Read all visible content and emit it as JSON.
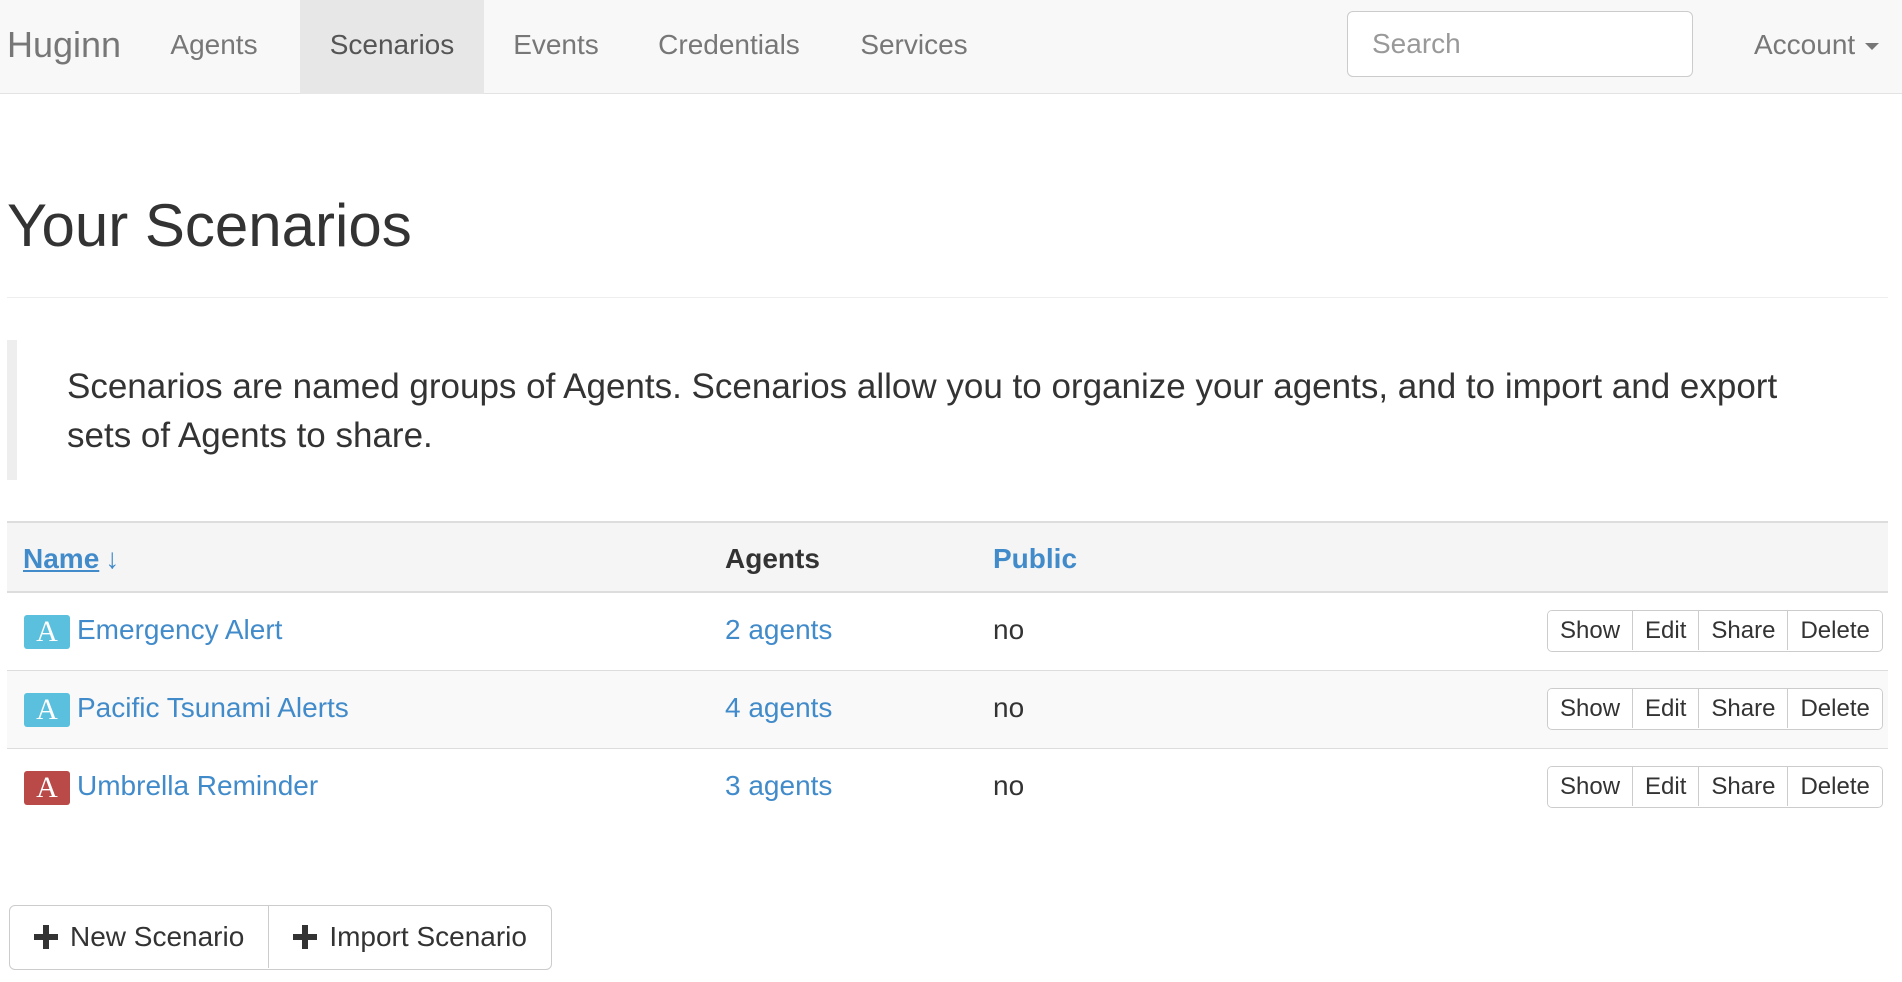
{
  "nav": {
    "brand": "Huginn",
    "items": [
      {
        "label": "Agents",
        "active": false
      },
      {
        "label": "Scenarios",
        "active": true
      },
      {
        "label": "Events",
        "active": false
      },
      {
        "label": "Credentials",
        "active": false
      },
      {
        "label": "Services",
        "active": false
      }
    ],
    "search_placeholder": "Search",
    "account_label": "Account"
  },
  "page": {
    "title": "Your Scenarios",
    "description": "Scenarios are named groups of Agents. Scenarios allow you to organize your agents, and to import and export sets of Agents to share."
  },
  "table": {
    "headers": {
      "name": "Name",
      "sort_indicator": "↓",
      "agents": "Agents",
      "public": "Public"
    },
    "rows": [
      {
        "icon_letter": "A",
        "icon_color": "#5bc0de",
        "name": "Emergency Alert",
        "agents": "2 agents",
        "public": "no"
      },
      {
        "icon_letter": "A",
        "icon_color": "#5bc0de",
        "name": "Pacific Tsunami Alerts",
        "agents": "4 agents",
        "public": "no"
      },
      {
        "icon_letter": "A",
        "icon_color": "#b94a48",
        "name": "Umbrella Reminder",
        "agents": "3 agents",
        "public": "no"
      }
    ],
    "row_actions": {
      "show": "Show",
      "edit": "Edit",
      "share": "Share",
      "delete": "Delete"
    }
  },
  "actions": {
    "new_scenario": "New Scenario",
    "import_scenario": "Import Scenario"
  },
  "colors": {
    "link": "#428bca",
    "navbar_bg": "#f8f8f8",
    "active_nav_bg": "#e7e7e7"
  }
}
